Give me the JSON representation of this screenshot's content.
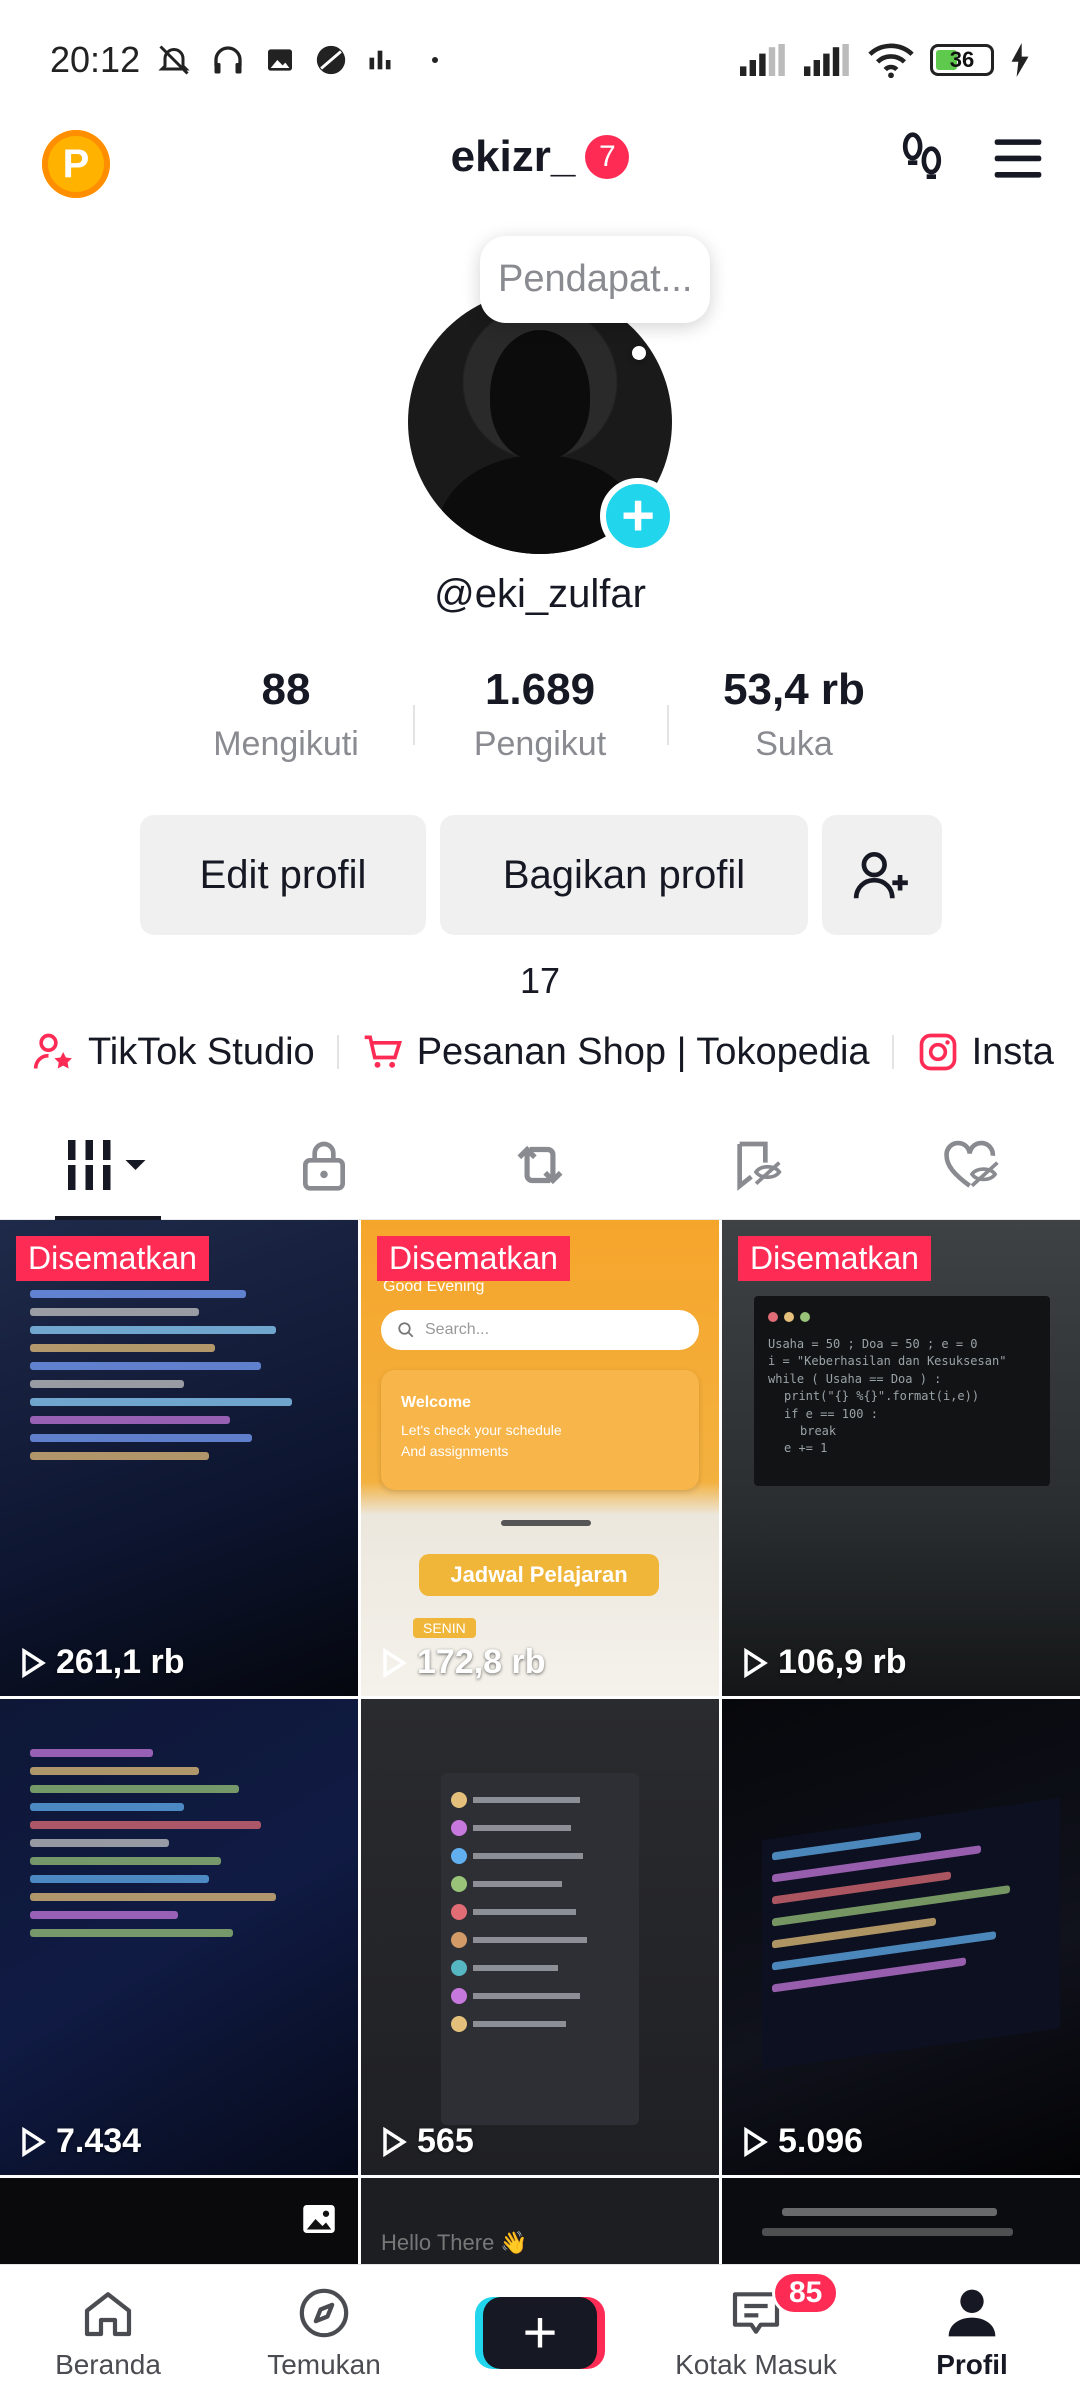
{
  "status_bar": {
    "time": "20:12",
    "battery": "36",
    "icons": [
      "bell-muted-icon",
      "headphones-icon",
      "gallery-icon",
      "app-icon",
      "chart-icon",
      "dot-icon",
      "signal-icon",
      "signal-icon",
      "wifi-icon",
      "battery-icon",
      "charging-icon"
    ]
  },
  "header": {
    "points_label": "P",
    "username": "ekizr_",
    "notification_count": "7"
  },
  "profile": {
    "note": "Pendapat...",
    "handle": "@eki_zulfar",
    "stats": [
      {
        "value": "88",
        "label": "Mengikuti"
      },
      {
        "value": "1.689",
        "label": "Pengikut"
      },
      {
        "value": "53,4 rb",
        "label": "Suka"
      }
    ],
    "edit_label": "Edit profil",
    "share_label": "Bagikan profil",
    "bio": "17"
  },
  "links": [
    {
      "label": "TikTok Studio",
      "icon": "person-star-icon"
    },
    {
      "label": "Pesanan Shop | Tokopedia",
      "icon": "cart-icon"
    },
    {
      "label": "Insta",
      "icon": "instagram-icon"
    }
  ],
  "tabs": [
    "videos-grid-icon",
    "lock-icon",
    "repost-icon",
    "saved-icon",
    "liked-icon"
  ],
  "videos": [
    {
      "pinned": "Disematkan",
      "views": "261,1 rb"
    },
    {
      "pinned": "Disematkan",
      "views": "172,8 rb"
    },
    {
      "pinned": "Disematkan",
      "views": "106,9 rb"
    },
    {
      "views": "7.434"
    },
    {
      "views": "565"
    },
    {
      "views": "5.096"
    }
  ],
  "thumb_texts": {
    "t2_greeting": "Good Evening",
    "t2_search": "Search...",
    "t2_welcome": "Welcome",
    "t2_welcome_sub": "Let's check your schedule And assignments",
    "t2_schedule": "Jadwal Pelajaran",
    "t2_day": "SENIN",
    "t3_code1": "Usaha = 50 ; Doa = 50 ; e = 0",
    "t3_code2": "i = \"Keberhasilan dan Kesuksesan\"",
    "t3_code3": "while ( Usaha == Doa ) :",
    "t3_code4": "print(\"{} %{}\".format(i,e))",
    "t3_code5": "if e == 100 :",
    "t3_code6": "break",
    "t3_code7": "e += 1",
    "t8_text": "Hello There 👋"
  },
  "bottom_nav": {
    "home": "Beranda",
    "discover": "Temukan",
    "create": "+",
    "inbox": "Kotak Masuk",
    "inbox_badge": "85",
    "profile": "Profil"
  }
}
